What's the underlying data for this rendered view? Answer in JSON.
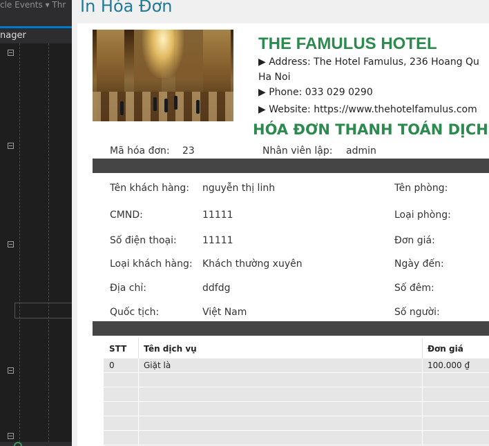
{
  "ide": {
    "events_label": "cle Events ▾ Thr",
    "tab_label": "nager"
  },
  "window": {
    "title": "In Hóa Đơn"
  },
  "hotel": {
    "name": "THE FAMULUS HOTEL",
    "address_line1": "▶ Address: The Hotel Famulus, 236 Hoang Qu",
    "address_line2": "Ha Noi",
    "phone": "▶ Phone: 033 029 0290",
    "website": "▶ Website: https://www.thehotelfamulus.com"
  },
  "invoice": {
    "title": "HÓA ĐƠN THANH TOÁN DỊCH V",
    "id_label": "Mã hóa đơn:",
    "id_value": "23",
    "staff_label": "Nhân viên lập:",
    "staff_value": "admin"
  },
  "customer": {
    "name_label": "Tên khách hàng:",
    "name_value": "nguyễn thị linh",
    "id_card_label": "CMND:",
    "id_card_value": "11111",
    "phone_label": "Số điện thoại:",
    "phone_value": "11111",
    "type_label": "Loại khách hàng:",
    "type_value": "Khách thường xuyên",
    "address_label": "Địa chỉ:",
    "address_value": "ddfdg",
    "nationality_label": "Quốc tịch:",
    "nationality_value": "Việt Nam"
  },
  "room": {
    "room_name_label": "Tên phòng:",
    "room_type_label": "Loại phòng:",
    "price_label": "Đơn giá:",
    "arrival_label": "Ngày đến:",
    "nights_label": "Số đêm:",
    "guests_label": "Số người:"
  },
  "services": {
    "columns": [
      "STT",
      "Tên dịch vụ",
      "Đơn giá"
    ],
    "rows": [
      [
        "0",
        "Giặt là",
        "100.000 ₫"
      ]
    ]
  }
}
